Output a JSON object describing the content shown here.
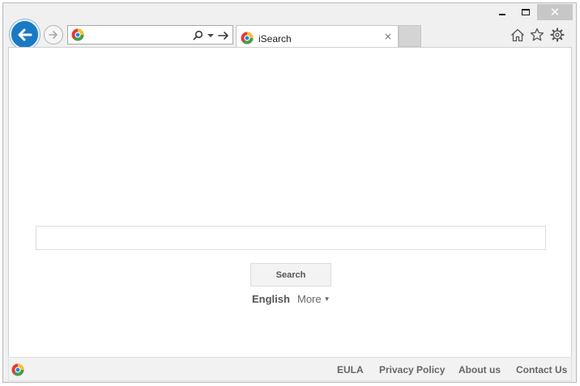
{
  "window": {
    "minimize_icon": "minimize-icon",
    "maximize_icon": "maximize-icon",
    "close_glyph": "✕"
  },
  "nav": {
    "back_icon": "back-arrow-icon",
    "forward_icon": "forward-arrow-icon"
  },
  "address_bar": {
    "value": "",
    "placeholder": "",
    "search_icon": "search-icon",
    "dropdown_icon": "chevron-down-icon",
    "go_icon": "go-arrow-icon"
  },
  "tabs": [
    {
      "title": "iSearch",
      "close": "×"
    }
  ],
  "toolbar_icons": [
    "home-icon",
    "star-icon",
    "gear-icon"
  ],
  "page": {
    "search_value": "",
    "search_button": "Search",
    "language": "English",
    "more_label": "More",
    "more_arrow": "▼"
  },
  "footer": {
    "links": [
      "EULA",
      "Privacy Policy",
      "About us",
      "Contact Us"
    ]
  },
  "colors": {
    "accent": "#1a79c4",
    "chrome_bg": "#f0f0f0",
    "close_button": "#c7c7c7",
    "footer_bg": "#f2f2f2",
    "link_text": "#666666"
  }
}
